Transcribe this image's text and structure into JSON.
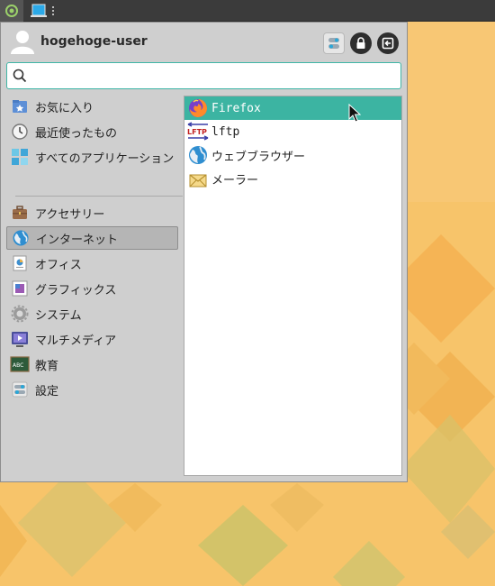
{
  "user": {
    "name": "hogehoge-user"
  },
  "search": {
    "value": "",
    "placeholder": ""
  },
  "categories": [
    {
      "label": "お気に入り",
      "icon": "star-folder-icon"
    },
    {
      "label": "最近使ったもの",
      "icon": "clock-icon"
    },
    {
      "label": "すべてのアプリケーション",
      "icon": "grid-icon"
    },
    {
      "label": "アクセサリー",
      "icon": "briefcase-icon"
    },
    {
      "label": "インターネット",
      "icon": "globe-icon",
      "active": true
    },
    {
      "label": "オフィス",
      "icon": "office-icon"
    },
    {
      "label": "グラフィックス",
      "icon": "graphics-icon"
    },
    {
      "label": "システム",
      "icon": "gear-icon"
    },
    {
      "label": "マルチメディア",
      "icon": "multimedia-icon"
    },
    {
      "label": "教育",
      "icon": "education-icon"
    },
    {
      "label": "設定",
      "icon": "settings-icon"
    }
  ],
  "apps": [
    {
      "label": "Firefox",
      "icon": "firefox-icon",
      "selected": true
    },
    {
      "label": "lftp",
      "icon": "lftp-icon"
    },
    {
      "label": "ウェブブラウザー",
      "icon": "web-browser-icon"
    },
    {
      "label": "メーラー",
      "icon": "mail-icon"
    }
  ],
  "colors": {
    "accent": "#3cb4a2",
    "panel": "#3b3b3b",
    "menu_bg": "#cfcfcf",
    "wallpaper": "#f6c166"
  }
}
